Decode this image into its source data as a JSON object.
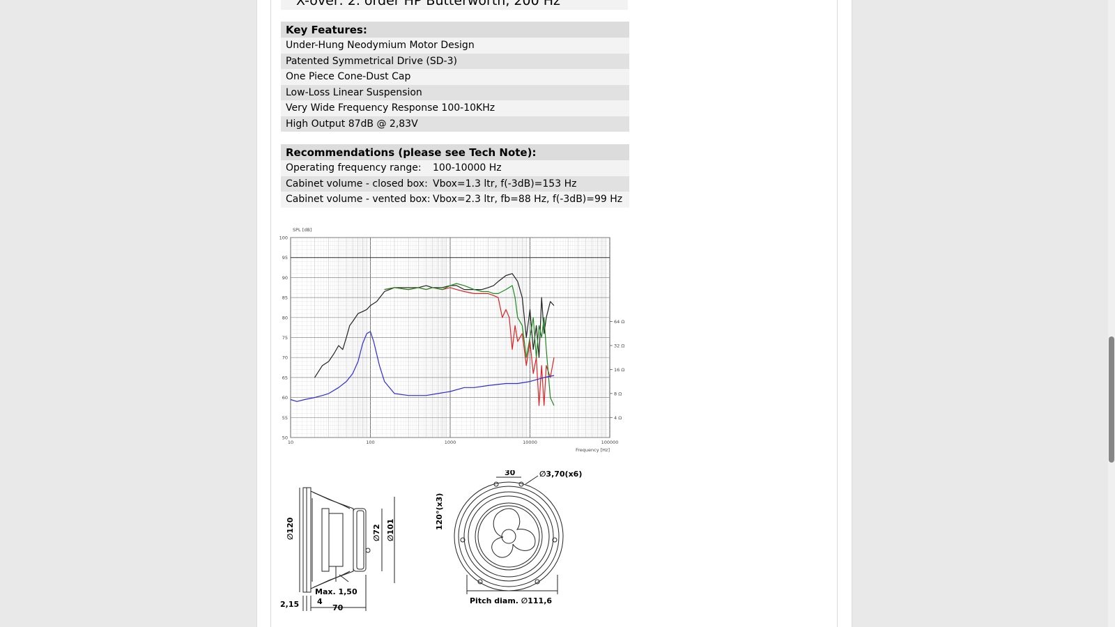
{
  "top_partial_text": "X-over: 2. order HP Butterworth, 200 Hz",
  "features": {
    "title": "Key Features:",
    "items": [
      "Under-Hung Neodymium Motor Design",
      "Patented Symmetrical Drive (SD-3)",
      "One Piece Cone-Dust Cap",
      "Low-Loss Linear Suspension",
      "Very Wide Frequency Response 100-10KHz",
      "High Output 87dB @ 2,83V"
    ]
  },
  "recommendations": {
    "title": "Recommendations (please see Tech Note):",
    "rows": [
      {
        "label": "Operating frequency range:",
        "value": "100-10000 Hz"
      },
      {
        "label": "Cabinet volume - closed box:",
        "value": "Vbox=1.3 ltr, f(-3dB)=153 Hz"
      },
      {
        "label": "Cabinet volume - vented box:",
        "value": "Vbox=2.3 ltr, fb=88 Hz, f(-3dB)=99 Hz"
      }
    ]
  },
  "chart_data": {
    "type": "line",
    "title": "",
    "ylabel": "SPL [dB]",
    "xlabel": "Frequency [Hz]",
    "x_scale": "log",
    "xlim": [
      10,
      100000
    ],
    "ylim": [
      50,
      100
    ],
    "x_ticks": [
      "10",
      "100",
      "1000",
      "10000",
      "100000"
    ],
    "y_ticks": [
      "50",
      "55",
      "60",
      "65",
      "70",
      "75",
      "80",
      "85",
      "90",
      "95",
      "100"
    ],
    "y2_ticks": [
      "4 Ω",
      "8 Ω",
      "16 Ω",
      "32 Ω",
      "64 Ω"
    ],
    "grid": true,
    "colors": {
      "black": "#222222",
      "red": "#e02020",
      "green": "#1a8a1a",
      "blue": "#2b2bdd"
    },
    "series": [
      {
        "color": "black",
        "x": [
          20,
          25,
          30,
          35,
          40,
          45,
          50,
          55,
          60,
          70,
          80,
          90,
          100,
          120,
          150,
          200,
          300,
          400,
          500,
          600,
          800,
          1000,
          1200,
          1500,
          2000,
          2500,
          3000,
          3500,
          4000,
          5000,
          6000,
          7000,
          8000,
          9000,
          10000,
          11000,
          12000,
          13000,
          14000,
          15000,
          16000,
          18000,
          20000
        ],
        "y": [
          65,
          68,
          69,
          71,
          73,
          72,
          75,
          78,
          79,
          81,
          81.5,
          82,
          83,
          84,
          86.5,
          87.5,
          87.5,
          87.5,
          88,
          87.5,
          87.5,
          88,
          88,
          87,
          87,
          87,
          87.5,
          88,
          89,
          90.5,
          91,
          89,
          85,
          75,
          82,
          72,
          78,
          70,
          85,
          76,
          80,
          84,
          83
        ]
      },
      {
        "color": "red",
        "x": [
          150,
          200,
          300,
          400,
          500,
          600,
          800,
          1000,
          1200,
          1500,
          2000,
          2500,
          3000,
          3500,
          4000,
          4500,
          5000,
          5500,
          6000,
          6500,
          7000,
          8000,
          9000,
          10000,
          11000,
          12000,
          13000,
          14000,
          15000,
          16000,
          18000,
          20000
        ],
        "y": [
          87,
          87.5,
          87,
          87.5,
          87,
          87.5,
          87,
          87.5,
          87,
          86.5,
          86,
          86,
          86,
          85.5,
          85,
          80,
          82,
          80,
          72,
          78,
          74,
          76,
          68,
          74,
          66,
          70,
          58,
          68,
          58,
          68,
          65,
          70
        ]
      },
      {
        "color": "green",
        "x": [
          150,
          200,
          300,
          400,
          500,
          600,
          800,
          1000,
          1200,
          1500,
          2000,
          2500,
          3000,
          3500,
          4000,
          5000,
          6000,
          6500,
          7000,
          8000,
          9000,
          10000,
          11000,
          12000,
          13000,
          14000,
          15000,
          16000,
          18000,
          20000
        ],
        "y": [
          87,
          87.5,
          87,
          87.5,
          87,
          87.5,
          87,
          88,
          88.5,
          88,
          87,
          86.5,
          86.5,
          86,
          86,
          87,
          88,
          85,
          80,
          78,
          70,
          75,
          80,
          70,
          78,
          75,
          80,
          72,
          60,
          58
        ]
      },
      {
        "color": "blue",
        "x": [
          10,
          12,
          15,
          20,
          25,
          30,
          40,
          50,
          60,
          70,
          80,
          90,
          100,
          110,
          130,
          150,
          200,
          300,
          400,
          500,
          700,
          1000,
          1500,
          2000,
          3000,
          5000,
          7000,
          10000,
          15000,
          20000
        ],
        "y": [
          59.5,
          59,
          59.5,
          60,
          60.5,
          61,
          62.5,
          64,
          66,
          69,
          73.5,
          76,
          76.5,
          74,
          68,
          64,
          61,
          60.5,
          60.5,
          60.5,
          61,
          61.5,
          62.5,
          62.5,
          63,
          63.5,
          63.5,
          64,
          65,
          65.5
        ]
      }
    ]
  },
  "drawing": {
    "side_view": {
      "labels": [
        "∅120",
        "∅72",
        "∅101",
        "Max. 1,50",
        "4",
        "2,15",
        "70"
      ]
    },
    "front_view": {
      "labels": [
        "30",
        "∅3,70(x6)",
        "120°(x3)",
        "Pitch diam.  ∅111,6"
      ]
    }
  }
}
